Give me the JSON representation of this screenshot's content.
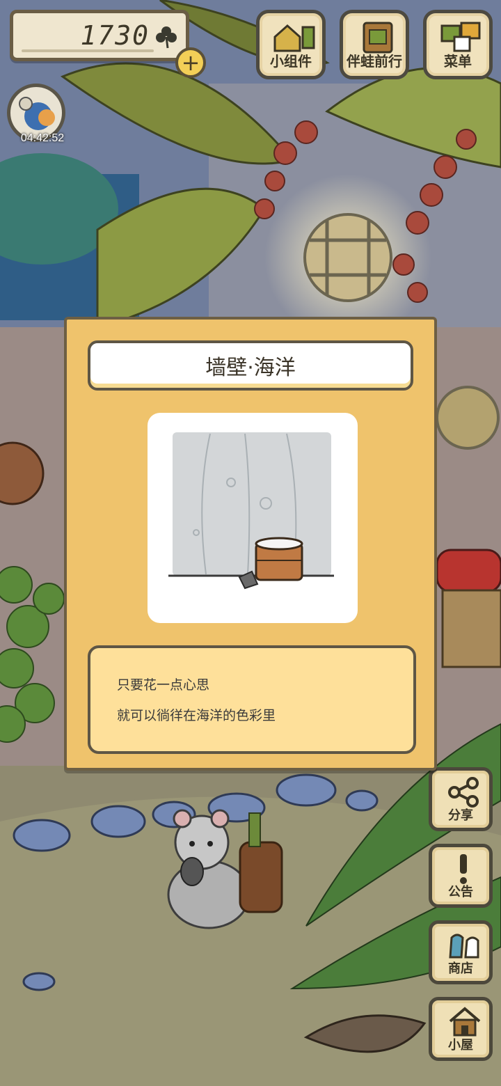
{
  "currency": {
    "value": "1730",
    "icon": "clover-icon",
    "add_icon": "plus-icon"
  },
  "timer": {
    "text": "04:42:52"
  },
  "top_buttons": [
    {
      "label": "小组件",
      "icon": "widget-icon"
    },
    {
      "label": "伴蛙前行",
      "icon": "frog-companion-icon"
    },
    {
      "label": "菜单",
      "icon": "menu-icon"
    }
  ],
  "side_buttons": [
    {
      "label": "分享",
      "icon": "share-icon"
    },
    {
      "label": "公告",
      "icon": "announcement-icon"
    },
    {
      "label": "商店",
      "icon": "shop-icon"
    },
    {
      "label": "小屋",
      "icon": "house-icon"
    }
  ],
  "item": {
    "title": "墙壁·海洋",
    "description_lines": [
      "只要花一点心思",
      "就可以徜徉在海洋的色彩里"
    ]
  },
  "colors": {
    "dialog_bg": "#efc36c",
    "description_bg": "#fee09a",
    "button_bg": "#efe0b6",
    "outline": "#4c483b"
  }
}
